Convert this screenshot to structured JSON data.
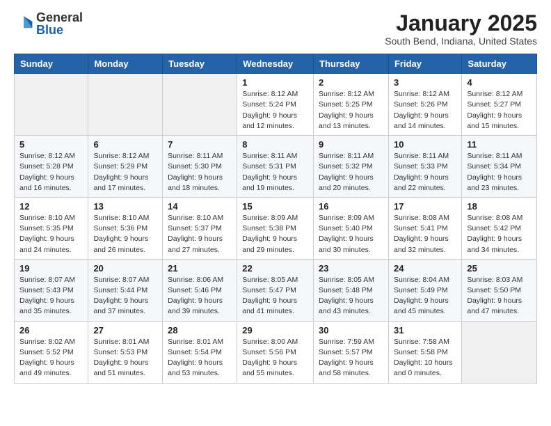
{
  "logo": {
    "text_general": "General",
    "text_blue": "Blue"
  },
  "header": {
    "title": "January 2025",
    "subtitle": "South Bend, Indiana, United States"
  },
  "days_of_week": [
    "Sunday",
    "Monday",
    "Tuesday",
    "Wednesday",
    "Thursday",
    "Friday",
    "Saturday"
  ],
  "weeks": [
    [
      {
        "day": "",
        "info": ""
      },
      {
        "day": "",
        "info": ""
      },
      {
        "day": "",
        "info": ""
      },
      {
        "day": "1",
        "info": "Sunrise: 8:12 AM\nSunset: 5:24 PM\nDaylight: 9 hours\nand 12 minutes."
      },
      {
        "day": "2",
        "info": "Sunrise: 8:12 AM\nSunset: 5:25 PM\nDaylight: 9 hours\nand 13 minutes."
      },
      {
        "day": "3",
        "info": "Sunrise: 8:12 AM\nSunset: 5:26 PM\nDaylight: 9 hours\nand 14 minutes."
      },
      {
        "day": "4",
        "info": "Sunrise: 8:12 AM\nSunset: 5:27 PM\nDaylight: 9 hours\nand 15 minutes."
      }
    ],
    [
      {
        "day": "5",
        "info": "Sunrise: 8:12 AM\nSunset: 5:28 PM\nDaylight: 9 hours\nand 16 minutes."
      },
      {
        "day": "6",
        "info": "Sunrise: 8:12 AM\nSunset: 5:29 PM\nDaylight: 9 hours\nand 17 minutes."
      },
      {
        "day": "7",
        "info": "Sunrise: 8:11 AM\nSunset: 5:30 PM\nDaylight: 9 hours\nand 18 minutes."
      },
      {
        "day": "8",
        "info": "Sunrise: 8:11 AM\nSunset: 5:31 PM\nDaylight: 9 hours\nand 19 minutes."
      },
      {
        "day": "9",
        "info": "Sunrise: 8:11 AM\nSunset: 5:32 PM\nDaylight: 9 hours\nand 20 minutes."
      },
      {
        "day": "10",
        "info": "Sunrise: 8:11 AM\nSunset: 5:33 PM\nDaylight: 9 hours\nand 22 minutes."
      },
      {
        "day": "11",
        "info": "Sunrise: 8:11 AM\nSunset: 5:34 PM\nDaylight: 9 hours\nand 23 minutes."
      }
    ],
    [
      {
        "day": "12",
        "info": "Sunrise: 8:10 AM\nSunset: 5:35 PM\nDaylight: 9 hours\nand 24 minutes."
      },
      {
        "day": "13",
        "info": "Sunrise: 8:10 AM\nSunset: 5:36 PM\nDaylight: 9 hours\nand 26 minutes."
      },
      {
        "day": "14",
        "info": "Sunrise: 8:10 AM\nSunset: 5:37 PM\nDaylight: 9 hours\nand 27 minutes."
      },
      {
        "day": "15",
        "info": "Sunrise: 8:09 AM\nSunset: 5:38 PM\nDaylight: 9 hours\nand 29 minutes."
      },
      {
        "day": "16",
        "info": "Sunrise: 8:09 AM\nSunset: 5:40 PM\nDaylight: 9 hours\nand 30 minutes."
      },
      {
        "day": "17",
        "info": "Sunrise: 8:08 AM\nSunset: 5:41 PM\nDaylight: 9 hours\nand 32 minutes."
      },
      {
        "day": "18",
        "info": "Sunrise: 8:08 AM\nSunset: 5:42 PM\nDaylight: 9 hours\nand 34 minutes."
      }
    ],
    [
      {
        "day": "19",
        "info": "Sunrise: 8:07 AM\nSunset: 5:43 PM\nDaylight: 9 hours\nand 35 minutes."
      },
      {
        "day": "20",
        "info": "Sunrise: 8:07 AM\nSunset: 5:44 PM\nDaylight: 9 hours\nand 37 minutes."
      },
      {
        "day": "21",
        "info": "Sunrise: 8:06 AM\nSunset: 5:46 PM\nDaylight: 9 hours\nand 39 minutes."
      },
      {
        "day": "22",
        "info": "Sunrise: 8:05 AM\nSunset: 5:47 PM\nDaylight: 9 hours\nand 41 minutes."
      },
      {
        "day": "23",
        "info": "Sunrise: 8:05 AM\nSunset: 5:48 PM\nDaylight: 9 hours\nand 43 minutes."
      },
      {
        "day": "24",
        "info": "Sunrise: 8:04 AM\nSunset: 5:49 PM\nDaylight: 9 hours\nand 45 minutes."
      },
      {
        "day": "25",
        "info": "Sunrise: 8:03 AM\nSunset: 5:50 PM\nDaylight: 9 hours\nand 47 minutes."
      }
    ],
    [
      {
        "day": "26",
        "info": "Sunrise: 8:02 AM\nSunset: 5:52 PM\nDaylight: 9 hours\nand 49 minutes."
      },
      {
        "day": "27",
        "info": "Sunrise: 8:01 AM\nSunset: 5:53 PM\nDaylight: 9 hours\nand 51 minutes."
      },
      {
        "day": "28",
        "info": "Sunrise: 8:01 AM\nSunset: 5:54 PM\nDaylight: 9 hours\nand 53 minutes."
      },
      {
        "day": "29",
        "info": "Sunrise: 8:00 AM\nSunset: 5:56 PM\nDaylight: 9 hours\nand 55 minutes."
      },
      {
        "day": "30",
        "info": "Sunrise: 7:59 AM\nSunset: 5:57 PM\nDaylight: 9 hours\nand 58 minutes."
      },
      {
        "day": "31",
        "info": "Sunrise: 7:58 AM\nSunset: 5:58 PM\nDaylight: 10 hours\nand 0 minutes."
      },
      {
        "day": "",
        "info": ""
      }
    ]
  ]
}
